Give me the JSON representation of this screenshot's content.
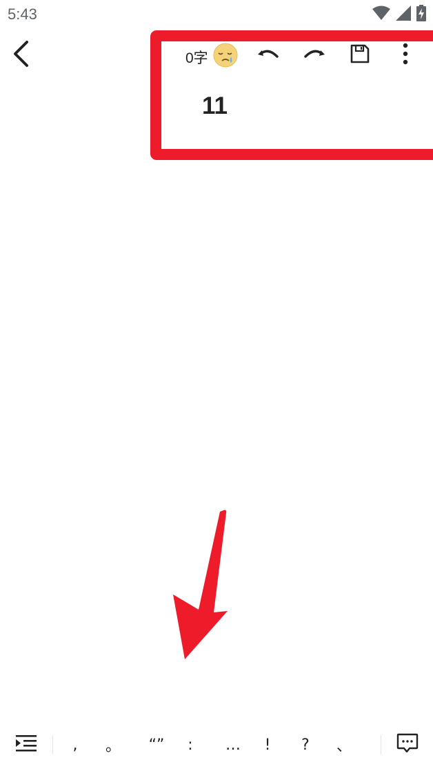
{
  "status_bar": {
    "time": "5:43",
    "icons": [
      "wifi-icon",
      "cell-signal-icon",
      "battery-charging-icon"
    ]
  },
  "toolbar": {
    "word_count": "0字",
    "mood_icon": "sleepy-face-icon",
    "undo_icon": "undo-icon",
    "redo_icon": "redo-icon",
    "save_icon": "save-icon",
    "more_icon": "more-vert-icon"
  },
  "document": {
    "title": "11"
  },
  "annotation": {
    "highlight_color": "#ee1c2a",
    "arrow_color": "#ee1c2a"
  },
  "bottom_bar": {
    "indent_icon": "indent-icon",
    "punctuation": [
      ",",
      "。",
      "“”",
      ":",
      "…",
      "!",
      "?",
      "、"
    ],
    "comment_icon": "comment-icon"
  }
}
